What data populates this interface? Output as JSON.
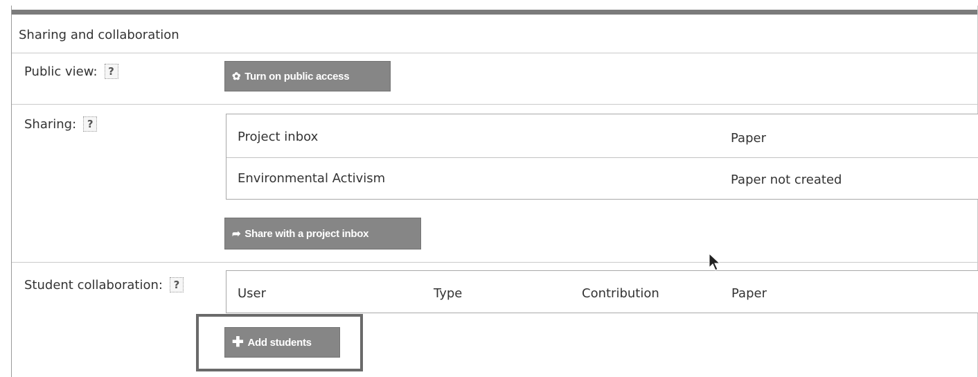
{
  "panel": {
    "title": "Sharing and collaboration"
  },
  "public_view": {
    "label": "Public view:",
    "help": "?",
    "button_label": "Turn on public access",
    "button_icon": "gear-icon"
  },
  "sharing": {
    "label": "Sharing:",
    "help": "?",
    "rows": [
      {
        "name": "Project inbox",
        "paper": "Paper"
      },
      {
        "name": "Environmental Activism",
        "paper": "Paper not created"
      }
    ],
    "button_label": "Share with a project inbox",
    "button_icon": "share-arrow-icon"
  },
  "student_collaboration": {
    "label": "Student collaboration:",
    "help": "?",
    "columns": [
      "User",
      "Type",
      "Contribution",
      "Paper"
    ],
    "button_label": "Add students",
    "button_icon": "plus-icon"
  },
  "colors": {
    "button_bg": "#868686",
    "button_text": "#ffffff",
    "border": "#c9c9c9",
    "highlight": "#6a6a6a"
  }
}
